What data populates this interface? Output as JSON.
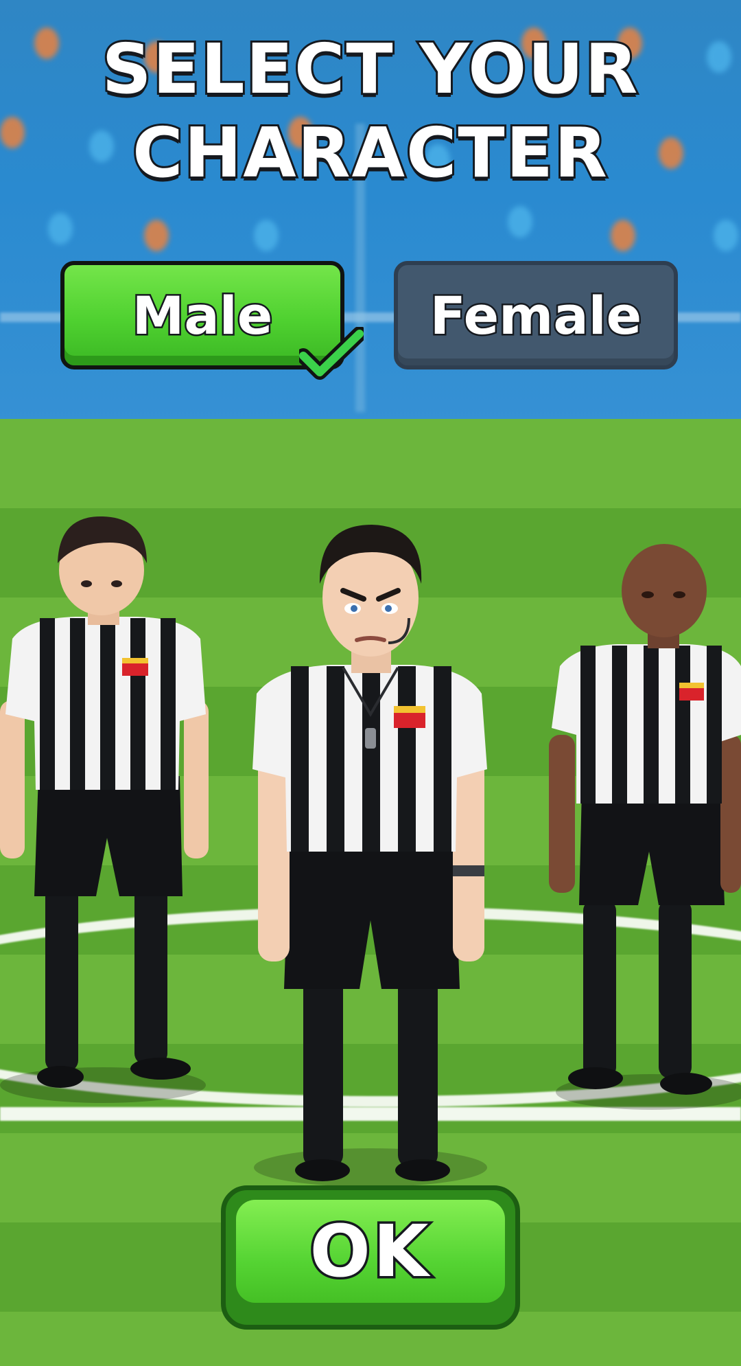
{
  "screen": {
    "title_line1": "SELECT YOUR",
    "title_line2": "CHARACTER"
  },
  "gender": {
    "male_label": "Male",
    "female_label": "Female",
    "selected": "Male"
  },
  "characters": [
    {
      "name": "referee-left",
      "skin": "#f0c8a8",
      "hair": "#2b1f1d"
    },
    {
      "name": "referee-center",
      "skin": "#f3cfb3",
      "hair": "#1d1816"
    },
    {
      "name": "referee-right",
      "skin": "#7a4a34",
      "hair": "none"
    }
  ],
  "actions": {
    "ok_label": "OK"
  },
  "colors": {
    "selected_button": "#4fd130",
    "unselected_button": "#42586e",
    "ok_button": "#55d433",
    "pitch": "#6cb63c",
    "stands": "#2f86c4"
  }
}
